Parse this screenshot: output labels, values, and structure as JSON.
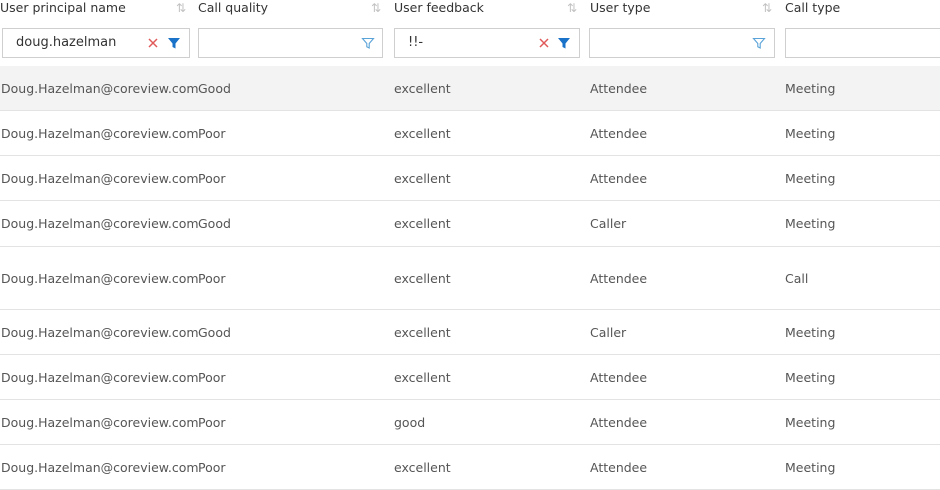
{
  "columns": [
    {
      "label": "User principal name"
    },
    {
      "label": "Call quality"
    },
    {
      "label": "User feedback"
    },
    {
      "label": "User type"
    },
    {
      "label": "Call type"
    }
  ],
  "filters": [
    {
      "value": "doug.hazelman",
      "active": true
    },
    {
      "value": "",
      "active": false
    },
    {
      "value": "!!-",
      "active": true
    },
    {
      "value": "",
      "active": false
    },
    {
      "value": "",
      "active": false
    }
  ],
  "rows": [
    {
      "upn": "Doug.Hazelman@coreview.com",
      "quality": "Good",
      "feedback": "excellent",
      "user_type": "Attendee",
      "call_type": "Meeting"
    },
    {
      "upn": "Doug.Hazelman@coreview.com",
      "quality": "Poor",
      "feedback": "excellent",
      "user_type": "Attendee",
      "call_type": "Meeting"
    },
    {
      "upn": "Doug.Hazelman@coreview.com",
      "quality": "Poor",
      "feedback": "excellent",
      "user_type": "Attendee",
      "call_type": "Meeting"
    },
    {
      "upn": "Doug.Hazelman@coreview.com",
      "quality": "Good",
      "feedback": "excellent",
      "user_type": "Caller",
      "call_type": "Meeting"
    },
    {
      "upn": "Doug.Hazelman@coreview.com",
      "quality": "Poor",
      "feedback": "excellent",
      "user_type": "Attendee",
      "call_type": "Call"
    },
    {
      "upn": "Doug.Hazelman@coreview.com",
      "quality": "Good",
      "feedback": "excellent",
      "user_type": "Caller",
      "call_type": "Meeting"
    },
    {
      "upn": "Doug.Hazelman@coreview.com",
      "quality": "Poor",
      "feedback": "excellent",
      "user_type": "Attendee",
      "call_type": "Meeting"
    },
    {
      "upn": "Doug.Hazelman@coreview.com",
      "quality": "Poor",
      "feedback": "good",
      "user_type": "Attendee",
      "call_type": "Meeting"
    },
    {
      "upn": "Doug.Hazelman@coreview.com",
      "quality": "Poor",
      "feedback": "excellent",
      "user_type": "Attendee",
      "call_type": "Meeting"
    }
  ],
  "colors": {
    "filter_icon_active": "#1a73c9",
    "filter_icon_inactive": "#5aa3d8",
    "clear_icon": "#e05a5a",
    "row_hover": "#f3f3f3"
  },
  "icons": {
    "sort": "sort-arrows-icon",
    "filter": "funnel-icon",
    "clear": "close-icon"
  }
}
